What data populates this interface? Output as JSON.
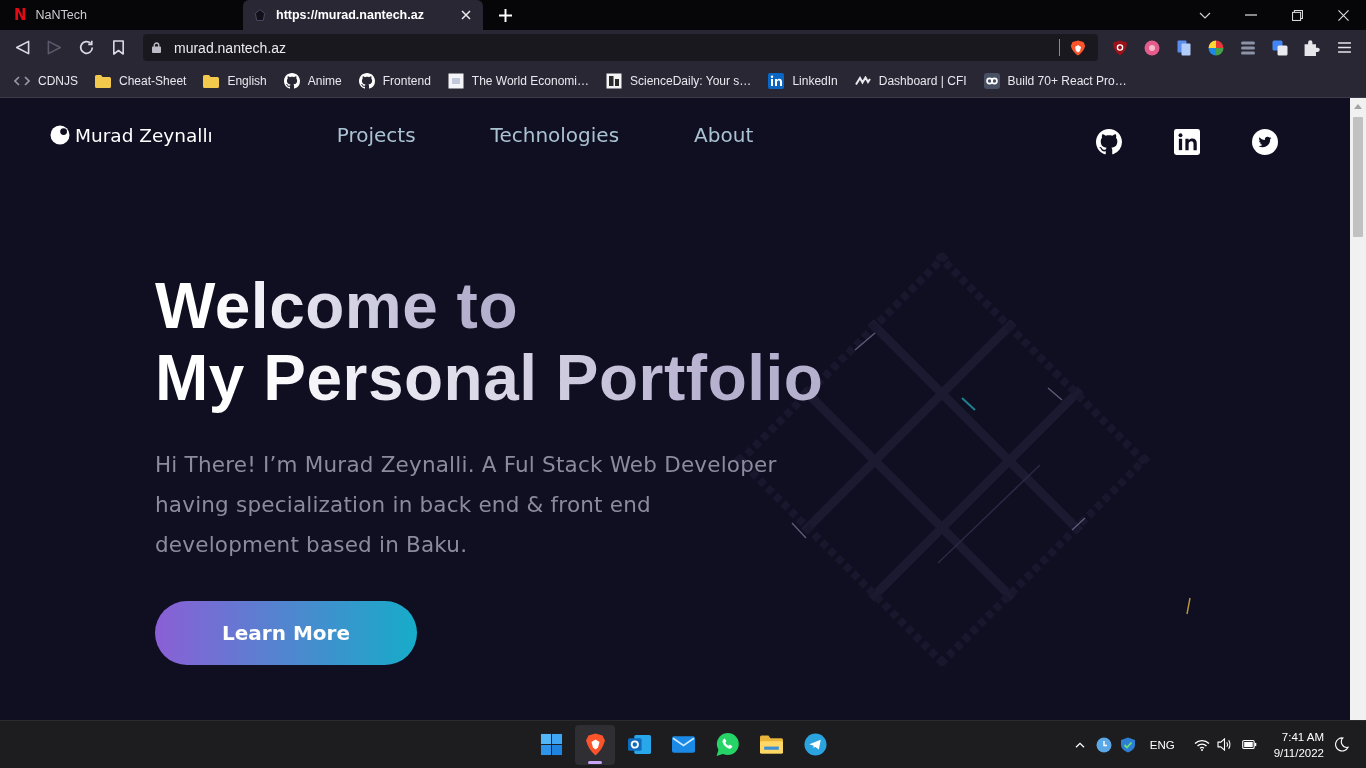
{
  "browser": {
    "tabs": [
      {
        "favicon": "N",
        "title": "NaNTech",
        "selected": false
      },
      {
        "title": "https://murad.nantech.az",
        "selected": true
      }
    ],
    "nav_buttons": [
      {
        "kind": "back",
        "disabled": false
      },
      {
        "kind": "forward",
        "disabled": true
      },
      {
        "kind": "reload",
        "disabled": false
      },
      {
        "kind": "bookmark",
        "disabled": false
      }
    ],
    "address": "murad.nantech.az",
    "bookmarks": [
      {
        "kind": "code",
        "label": "CDNJS"
      },
      {
        "kind": "folder",
        "label": "Cheat-Sheet"
      },
      {
        "kind": "folder",
        "label": "English"
      },
      {
        "kind": "github",
        "label": "Anime"
      },
      {
        "kind": "github",
        "label": "Frontend"
      },
      {
        "kind": "page",
        "label": "The World Economi…"
      },
      {
        "kind": "tile",
        "label": "ScienceDaily: Your s…"
      },
      {
        "kind": "linkedin",
        "label": "LinkedIn"
      },
      {
        "kind": "wave",
        "label": "Dashboard | CFI"
      },
      {
        "kind": "rings",
        "label": "Build 70+ React Pro…"
      }
    ]
  },
  "site": {
    "logo": "Murad Zeynallı",
    "nav": [
      "Projects",
      "Technologies",
      "About"
    ],
    "hero": {
      "title_lines": [
        "Welcome to",
        "My Personal Portfolio"
      ],
      "intro": "Hi There! I’m Murad Zeynalli. A Ful Stack Web Developer having specialization in back end & front end development based in Baku.",
      "button": "Learn More"
    }
  },
  "taskbar": {
    "apps": [
      {
        "kind": "start",
        "selected": false
      },
      {
        "kind": "browser",
        "selected": true
      },
      {
        "kind": "outlook",
        "selected": false
      },
      {
        "kind": "mail",
        "selected": false
      },
      {
        "kind": "whatsapp",
        "selected": false
      },
      {
        "kind": "explorer",
        "selected": false
      },
      {
        "kind": "telegram",
        "selected": false
      }
    ],
    "language": "ENG",
    "time": "7:41 AM",
    "date": "9/11/2022"
  }
}
